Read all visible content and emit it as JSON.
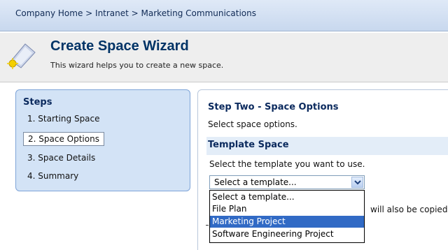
{
  "breadcrumb": {
    "items": [
      "Company Home",
      "Intranet",
      "Marketing Communications"
    ],
    "separator": ">",
    "text": "Company Home > Intranet > Marketing Communications"
  },
  "header": {
    "title": "Create Space Wizard",
    "subtitle": "This wizard helps you to create a new space.",
    "icon": "wizard-wand-icon"
  },
  "steps": {
    "heading": "Steps",
    "items": [
      {
        "label": "1. Starting Space",
        "active": false
      },
      {
        "label": "2. Space Options",
        "active": true
      },
      {
        "label": "3. Space Details",
        "active": false
      },
      {
        "label": "4. Summary",
        "active": false
      }
    ]
  },
  "content": {
    "step_title": "Step Two - Space Options",
    "step_desc": "Select space options.",
    "section_title": "Template Space",
    "instruction": "Select the template you want to use.",
    "select_value": "Select a template...",
    "options": [
      {
        "label": "Select a template...",
        "highlighted": false
      },
      {
        "label": "File Plan",
        "highlighted": false
      },
      {
        "label": "Marketing Project",
        "highlighted": true
      },
      {
        "label": "Software Engineering Project",
        "highlighted": false
      }
    ],
    "obscured_text": "will also be copied"
  },
  "colors": {
    "accent": "#316ac5",
    "header_text": "#003366",
    "panel_bg": "#d3e3f6"
  }
}
